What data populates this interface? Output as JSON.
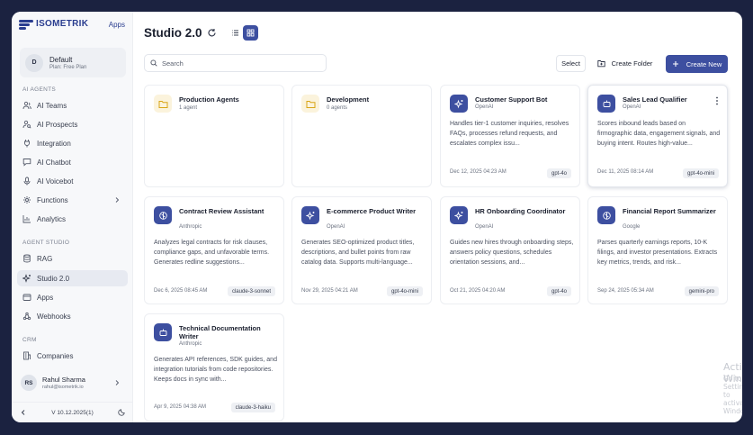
{
  "brand": {
    "name": "ISOMETRIK",
    "apps_link": "Apps"
  },
  "org": {
    "avatar": "D",
    "name": "Default",
    "plan": "Plan: Free Plan"
  },
  "sidebar": {
    "sections": {
      "ai_agents": "AI AGENTS",
      "agent_studio": "AGENT STUDIO",
      "crm": "CRM"
    },
    "items": [
      {
        "label": "AI Teams",
        "icon": "users-icon"
      },
      {
        "label": "AI Prospects",
        "icon": "search-user-icon"
      },
      {
        "label": "Integration",
        "icon": "plug-icon"
      },
      {
        "label": "AI Chatbot",
        "icon": "chat-icon"
      },
      {
        "label": "AI Voicebot",
        "icon": "microphone-icon"
      },
      {
        "label": "Functions",
        "icon": "functions-icon"
      },
      {
        "label": "Analytics",
        "icon": "chart-icon"
      },
      {
        "label": "RAG",
        "icon": "database-icon"
      },
      {
        "label": "Studio 2.0",
        "icon": "sparkle-icon",
        "active": true
      },
      {
        "label": "Apps",
        "icon": "folder-icon"
      },
      {
        "label": "Webhooks",
        "icon": "webhook-icon"
      },
      {
        "label": "Companies",
        "icon": "building-icon"
      }
    ]
  },
  "user": {
    "avatar": "RS",
    "name": "Rahul Sharma",
    "email": "rahul@isometrik.io"
  },
  "version": "V 10.12.2025(1)",
  "header": {
    "title": "Studio 2.0"
  },
  "search": {
    "placeholder": "Search"
  },
  "toolbar": {
    "select_label": "Select",
    "create_folder_label": "Create Folder",
    "create_new_label": "Create New"
  },
  "folders": [
    {
      "name": "Production Agents",
      "count": "1 agent"
    },
    {
      "name": "Development",
      "count": "0 agents"
    }
  ],
  "agents": [
    {
      "name": "Customer Support Bot",
      "provider": "OpenAI",
      "icon": "sparkle-icon",
      "description": "Handles tier-1 customer inquiries, resolves FAQs, processes refund requests, and escalates complex issu...",
      "date": "Dec 12, 2025 04:23 AM",
      "model": "gpt-4o"
    },
    {
      "name": "Sales Lead Qualifier",
      "provider": "OpenAI",
      "icon": "robot-icon",
      "description": "Scores inbound leads based on firmographic data, engagement signals, and buying intent. Routes high-value...",
      "date": "Dec 11, 2025 08:14 AM",
      "model": "gpt-4o-mini"
    },
    {
      "name": "Contract Review Assistant",
      "provider": "Anthropic",
      "icon": "brain-icon",
      "description": "Analyzes legal contracts for risk clauses, compliance gaps, and unfavorable terms. Generates redline suggestions...",
      "date": "Dec 6, 2025 08:45 AM",
      "model": "claude-3-sonnet"
    },
    {
      "name": "E-commerce Product Writer",
      "provider": "OpenAI",
      "icon": "sparkle-icon",
      "description": "Generates SEO-optimized product titles, descriptions, and bullet points from raw catalog data. Supports multi-language...",
      "date": "Nov 29, 2025 04:21 AM",
      "model": "gpt-4o-mini"
    },
    {
      "name": "HR Onboarding Coordinator",
      "provider": "OpenAI",
      "icon": "sparkle-icon",
      "description": "Guides new hires through onboarding steps, answers policy questions, schedules orientation sessions, and...",
      "date": "Oct 21, 2025 04:20 AM",
      "model": "gpt-4o"
    },
    {
      "name": "Financial Report Summarizer",
      "provider": "Google",
      "icon": "brain-icon",
      "description": "Parses quarterly earnings reports, 10-K filings, and investor presentations. Extracts key metrics, trends, and risk...",
      "date": "Sep 24, 2025 05:34 AM",
      "model": "gemini-pro"
    },
    {
      "name": "Technical Documentation Writer",
      "provider": "Anthropic",
      "icon": "robot-icon",
      "description": "Generates API references, SDK guides, and integration tutorials from code repositories. Keeps docs in sync with...",
      "date": "Apr 9, 2025 04:38 AM",
      "model": "claude-3-haiku"
    }
  ],
  "watermark": {
    "line1": "Activate Windows",
    "line2": "Go to Settings to activate Windows."
  },
  "colors": {
    "accent": "#3d4fa0",
    "brand": "#2a3d8f",
    "folder": "#e0b020"
  }
}
